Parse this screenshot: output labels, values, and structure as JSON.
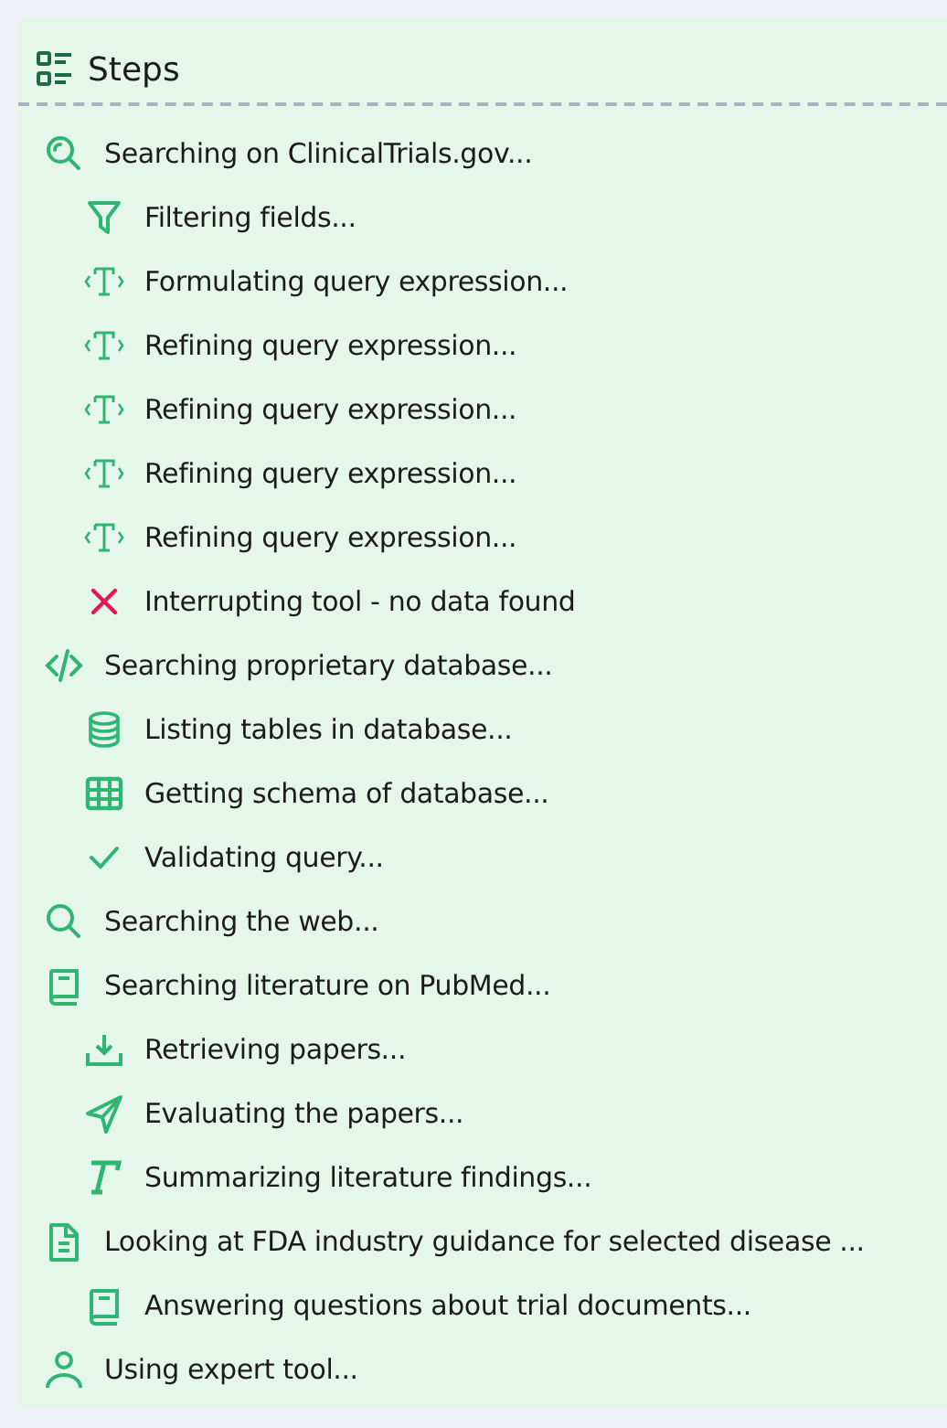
{
  "panel": {
    "title": "Steps"
  },
  "steps": [
    {
      "kind": "search",
      "label": "Searching on ClinicalTrials.gov...",
      "children": [
        {
          "kind": "filter",
          "label": "Filtering fields..."
        },
        {
          "kind": "template",
          "label": "Formulating query expression..."
        },
        {
          "kind": "template",
          "label": "Refining query expression..."
        },
        {
          "kind": "template",
          "label": "Refining query expression..."
        },
        {
          "kind": "template",
          "label": "Refining query expression..."
        },
        {
          "kind": "template",
          "label": "Refining query expression..."
        },
        {
          "kind": "error",
          "label": "Interrupting tool - no data found"
        }
      ]
    },
    {
      "kind": "code",
      "label": "Searching proprietary database...",
      "children": [
        {
          "kind": "database",
          "label": "Listing tables in database..."
        },
        {
          "kind": "table",
          "label": "Getting schema of database..."
        },
        {
          "kind": "check",
          "label": "Validating query..."
        }
      ]
    },
    {
      "kind": "web",
      "label": "Searching the web..."
    },
    {
      "kind": "book",
      "label": "Searching literature on PubMed...",
      "children": [
        {
          "kind": "download",
          "label": "Retrieving papers..."
        },
        {
          "kind": "send",
          "label": "Evaluating the papers..."
        },
        {
          "kind": "text",
          "label": "Summarizing literature findings..."
        }
      ]
    },
    {
      "kind": "document",
      "label": "Looking at FDA industry guidance for selected disease ...",
      "children": [
        {
          "kind": "book",
          "label": "Answering questions about trial documents..."
        }
      ]
    },
    {
      "kind": "person",
      "label": "Using expert tool..."
    }
  ]
}
